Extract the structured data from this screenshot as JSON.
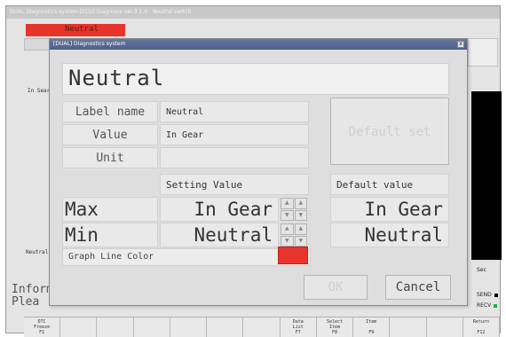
{
  "app": {
    "window_title": "DUAL Diagnostics system [ECU] Diagnosis ver.3.1.0 - Neutral switch",
    "neutral_tab": "Neutral",
    "side_label_1": "In Sear",
    "side_label_2": "Neutral",
    "info_label_1": "Inform",
    "info_label_2": "Plea",
    "sec_label": "Sec",
    "send_label": "SEND",
    "recv_label": "RECV",
    "colors": {
      "send": "#000000",
      "recv": "#22aa44",
      "accent": "#e8342b"
    }
  },
  "fkeys": [
    "DTC\nFreeze\nF1",
    "",
    "",
    "",
    "",
    "",
    "",
    "Data\nList\nF7",
    "Select\nItem\nF8",
    "Item\n \nF9",
    "",
    "",
    "Return\n \nF12"
  ],
  "dialog": {
    "title": "[DUAL] Diagnostics system",
    "close_glyph": "x",
    "heading": "Neutral",
    "label_name_caption": "Label name",
    "label_name_value": "Neutral",
    "value_caption": "Value",
    "value_value": "In Gear",
    "unit_caption": "Unit",
    "unit_value": "",
    "default_set_button": "Default set",
    "setting_value_header": "Setting Value",
    "default_value_header": "Default value",
    "max_label": "Max",
    "max_value": "In Gear",
    "max_default": "In Gear",
    "min_label": "Min",
    "min_value": "Neutral",
    "min_default": "Neutral",
    "graph_line_color_label": "Graph Line Color",
    "graph_line_color": "#e8342b",
    "ok_button": "OK",
    "cancel_button": "Cancel",
    "spinner_up": "▲",
    "spinner_down": "▼"
  }
}
